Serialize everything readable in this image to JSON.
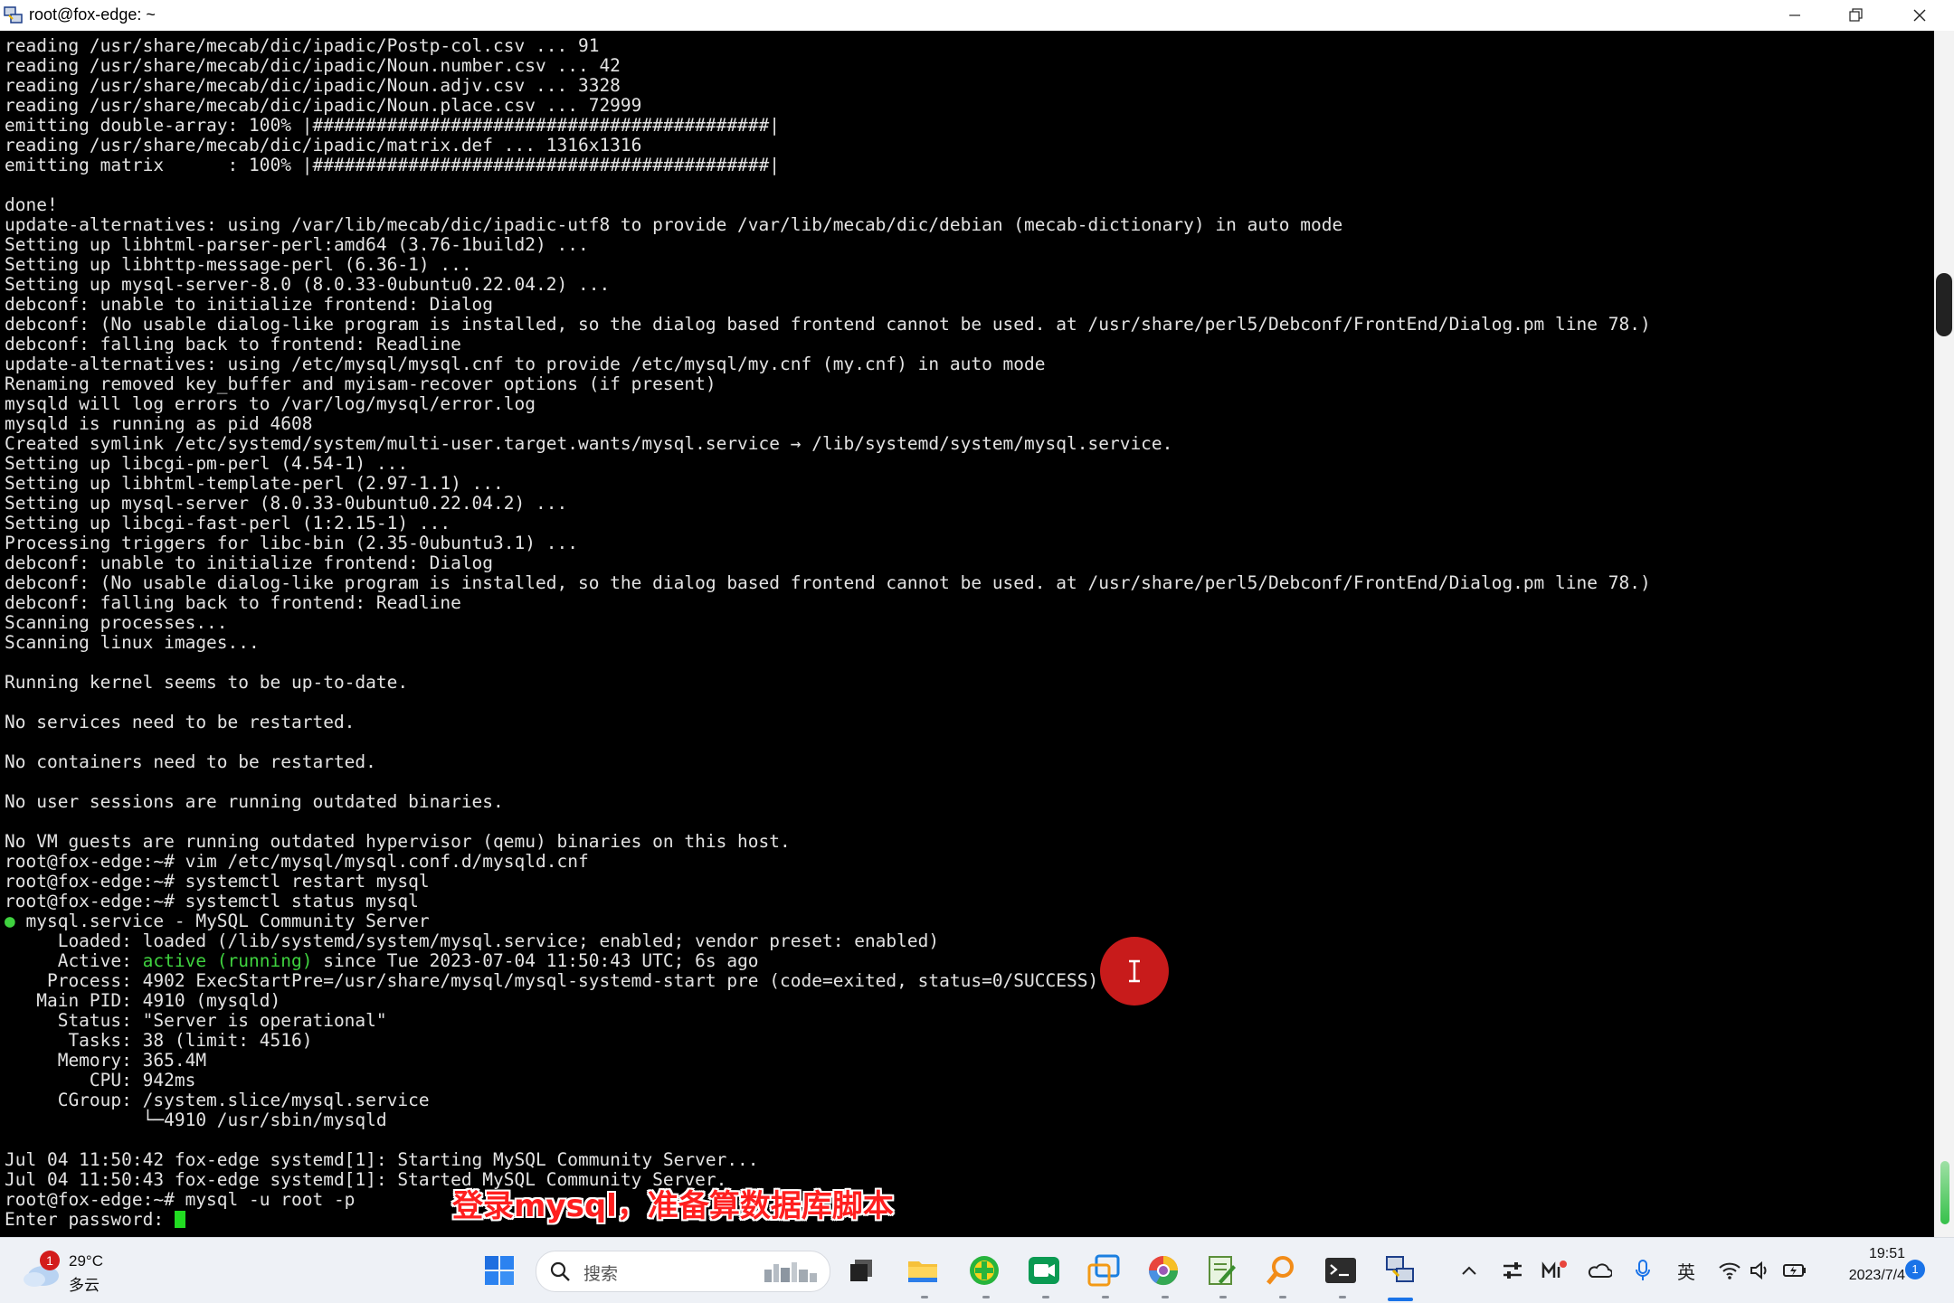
{
  "window": {
    "title": "root@fox-edge: ~",
    "app_icon": "putty-terminal-icon",
    "controls": [
      "minimize-icon",
      "maximize-icon",
      "close-icon"
    ]
  },
  "terminal": {
    "lines": [
      "reading /usr/share/mecab/dic/ipadic/Postp-col.csv ... 91",
      "reading /usr/share/mecab/dic/ipadic/Noun.number.csv ... 42",
      "reading /usr/share/mecab/dic/ipadic/Noun.adjv.csv ... 3328",
      "reading /usr/share/mecab/dic/ipadic/Noun.place.csv ... 72999",
      "emitting double-array: 100% |###########################################|",
      "reading /usr/share/mecab/dic/ipadic/matrix.def ... 1316x1316",
      "emitting matrix      : 100% |###########################################|",
      "",
      "done!",
      "update-alternatives: using /var/lib/mecab/dic/ipadic-utf8 to provide /var/lib/mecab/dic/debian (mecab-dictionary) in auto mode",
      "Setting up libhtml-parser-perl:amd64 (3.76-1build2) ...",
      "Setting up libhttp-message-perl (6.36-1) ...",
      "Setting up mysql-server-8.0 (8.0.33-0ubuntu0.22.04.2) ...",
      "debconf: unable to initialize frontend: Dialog",
      "debconf: (No usable dialog-like program is installed, so the dialog based frontend cannot be used. at /usr/share/perl5/Debconf/FrontEnd/Dialog.pm line 78.)",
      "debconf: falling back to frontend: Readline",
      "update-alternatives: using /etc/mysql/mysql.cnf to provide /etc/mysql/my.cnf (my.cnf) in auto mode",
      "Renaming removed key_buffer and myisam-recover options (if present)",
      "mysqld will log errors to /var/log/mysql/error.log",
      "mysqld is running as pid 4608",
      "Created symlink /etc/systemd/system/multi-user.target.wants/mysql.service → /lib/systemd/system/mysql.service.",
      "Setting up libcgi-pm-perl (4.54-1) ...",
      "Setting up libhtml-template-perl (2.97-1.1) ...",
      "Setting up mysql-server (8.0.33-0ubuntu0.22.04.2) ...",
      "Setting up libcgi-fast-perl (1:2.15-1) ...",
      "Processing triggers for libc-bin (2.35-0ubuntu3.1) ...",
      "debconf: unable to initialize frontend: Dialog",
      "debconf: (No usable dialog-like program is installed, so the dialog based frontend cannot be used. at /usr/share/perl5/Debconf/FrontEnd/Dialog.pm line 78.)",
      "debconf: falling back to frontend: Readline",
      "Scanning processes...",
      "Scanning linux images...",
      "",
      "Running kernel seems to be up-to-date.",
      "",
      "No services need to be restarted.",
      "",
      "No containers need to be restarted.",
      "",
      "No user sessions are running outdated binaries.",
      "",
      "No VM guests are running outdated hypervisor (qemu) binaries on this host.",
      "root@fox-edge:~# vim /etc/mysql/mysql.conf.d/mysqld.cnf",
      "root@fox-edge:~# systemctl restart mysql",
      "root@fox-edge:~# systemctl status mysql"
    ],
    "status_bullet": "●",
    "status_title": " mysql.service - MySQL Community Server",
    "loaded_line": "     Loaded: loaded (/lib/systemd/system/mysql.service; enabled; vendor preset: enabled)",
    "active_label": "     Active: ",
    "active_value": "active (running)",
    "active_rest": " since Tue 2023-07-04 11:50:43 UTC; 6s ago",
    "status_lines": [
      "    Process: 4902 ExecStartPre=/usr/share/mysql/mysql-systemd-start pre (code=exited, status=0/SUCCESS)",
      "   Main PID: 4910 (mysqld)",
      "     Status: \"Server is operational\"",
      "      Tasks: 38 (limit: 4516)",
      "     Memory: 365.4M",
      "        CPU: 942ms",
      "     CGroup: /system.slice/mysql.service",
      "             └─4910 /usr/sbin/mysqld",
      "",
      "Jul 04 11:50:42 fox-edge systemd[1]: Starting MySQL Community Server...",
      "Jul 04 11:50:43 fox-edge systemd[1]: Started MySQL Community Server.",
      "root@fox-edge:~# mysql -u root -p"
    ],
    "prompt_line": "Enter password: "
  },
  "subtitle": "登录mysql，准备算数据库脚本",
  "colors": {
    "terminal_bg": "#000000",
    "terminal_fg": "#e3e3e3",
    "active_green": "#3fd23f",
    "marker_red": "#c81b1b",
    "subtitle_red": "#ff1f1f"
  },
  "taskbar": {
    "weather_badge": "1",
    "weather_temp": "29°C",
    "weather_condition": "多云",
    "search_placeholder": "搜索",
    "apps": [
      "start-icon",
      "search-icon",
      "task-view-icon",
      "file-explorer-icon",
      "green-plus-app-icon",
      "video-meeting-icon",
      "remote-desktop-icon",
      "browser-icon",
      "notepad-icon",
      "search-tool-icon",
      "terminal-icon",
      "putty-icon"
    ],
    "tray": [
      "chevron-up-icon",
      "settings-sliders-icon",
      "input-method-icon",
      "onedrive-icon",
      "microphone-icon",
      "wifi-icon",
      "volume-icon",
      "battery-icon"
    ],
    "ime_label": "英",
    "time": "19:51",
    "date": "2023/7/4",
    "notification_count": "1"
  }
}
